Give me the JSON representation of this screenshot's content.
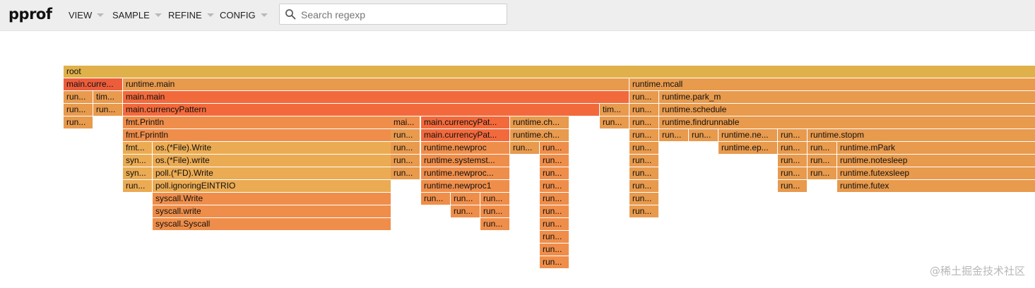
{
  "app": {
    "title": "pprof"
  },
  "menu": [
    {
      "label": "VIEW"
    },
    {
      "label": "SAMPLE"
    },
    {
      "label": "REFINE"
    },
    {
      "label": "CONFIG"
    }
  ],
  "search": {
    "placeholder": "Search regexp",
    "value": ""
  },
  "flamegraph": {
    "colors": {
      "root": "#e0b14b",
      "hot": "#f26a3c",
      "red": "#ec5d3b",
      "warm": "#ef8e4a",
      "mid": "#e89a4d",
      "light": "#ebab53"
    },
    "frames": [
      {
        "label": "root",
        "color": "root"
      },
      {
        "label": "main.curre...",
        "color": "red"
      },
      {
        "label": "runtime.main",
        "color": "mid"
      },
      {
        "label": "runtime.mcall",
        "color": "mid"
      },
      {
        "label": "run...",
        "color": "mid"
      },
      {
        "label": "tim...",
        "color": "mid"
      },
      {
        "label": "main.main",
        "color": "hot"
      },
      {
        "label": "run...",
        "color": "mid"
      },
      {
        "label": "runtime.park_m",
        "color": "mid"
      },
      {
        "label": "run...",
        "color": "mid"
      },
      {
        "label": "run...",
        "color": "mid"
      },
      {
        "label": "main.currencyPattern",
        "color": "hot"
      },
      {
        "label": "tim...",
        "color": "mid"
      },
      {
        "label": "run...",
        "color": "mid"
      },
      {
        "label": "runtime.schedule",
        "color": "mid"
      },
      {
        "label": "run...",
        "color": "mid"
      },
      {
        "label": "fmt.Println",
        "color": "warm"
      },
      {
        "label": "mai...",
        "color": "warm"
      },
      {
        "label": "main.currencyPat...",
        "color": "hot"
      },
      {
        "label": "runtime.ch...",
        "color": "mid"
      },
      {
        "label": "run...",
        "color": "mid"
      },
      {
        "label": "run...",
        "color": "mid"
      },
      {
        "label": "runtime.findrunnable",
        "color": "mid"
      },
      {
        "label": "fmt.Fprintln",
        "color": "warm"
      },
      {
        "label": "run...",
        "color": "mid"
      },
      {
        "label": "main.currencyPat...",
        "color": "hot"
      },
      {
        "label": "runtime.ch...",
        "color": "mid"
      },
      {
        "label": "run...",
        "color": "mid"
      },
      {
        "label": "run...",
        "color": "mid"
      },
      {
        "label": "run...",
        "color": "mid"
      },
      {
        "label": "runtime.ne...",
        "color": "mid"
      },
      {
        "label": "run...",
        "color": "mid"
      },
      {
        "label": "runtime.stopm",
        "color": "mid"
      },
      {
        "label": "fmt...",
        "color": "light"
      },
      {
        "label": "os.(*File).Write",
        "color": "light"
      },
      {
        "label": "run...",
        "color": "mid"
      },
      {
        "label": "runtime.newproc",
        "color": "warm"
      },
      {
        "label": "run...",
        "color": "mid"
      },
      {
        "label": "run...",
        "color": "warm"
      },
      {
        "label": "run...",
        "color": "mid"
      },
      {
        "label": "runtime.ep...",
        "color": "mid"
      },
      {
        "label": "run...",
        "color": "mid"
      },
      {
        "label": "run...",
        "color": "mid"
      },
      {
        "label": "runtime.mPark",
        "color": "mid"
      },
      {
        "label": "syn...",
        "color": "light"
      },
      {
        "label": "os.(*File).write",
        "color": "light"
      },
      {
        "label": "run...",
        "color": "mid"
      },
      {
        "label": "runtime.systemst...",
        "color": "warm"
      },
      {
        "label": "run...",
        "color": "warm"
      },
      {
        "label": "run...",
        "color": "mid"
      },
      {
        "label": "run...",
        "color": "mid"
      },
      {
        "label": "run...",
        "color": "mid"
      },
      {
        "label": "runtime.notesleep",
        "color": "mid"
      },
      {
        "label": "syn...",
        "color": "light"
      },
      {
        "label": "poll.(*FD).Write",
        "color": "light"
      },
      {
        "label": "run...",
        "color": "mid"
      },
      {
        "label": "runtime.newproc...",
        "color": "warm"
      },
      {
        "label": "run...",
        "color": "warm"
      },
      {
        "label": "run...",
        "color": "mid"
      },
      {
        "label": "run...",
        "color": "mid"
      },
      {
        "label": "run...",
        "color": "mid"
      },
      {
        "label": "runtime.futexsleep",
        "color": "mid"
      },
      {
        "label": "run...",
        "color": "light"
      },
      {
        "label": "poll.ignoringEINTRIO",
        "color": "light"
      },
      {
        "label": "runtime.newproc1",
        "color": "warm"
      },
      {
        "label": "run...",
        "color": "warm"
      },
      {
        "label": "run...",
        "color": "mid"
      },
      {
        "label": "run...",
        "color": "mid"
      },
      {
        "label": "runtime.futex",
        "color": "mid"
      },
      {
        "label": "syscall.Write",
        "color": "warm"
      },
      {
        "label": "run...",
        "color": "warm"
      },
      {
        "label": "run...",
        "color": "warm"
      },
      {
        "label": "run...",
        "color": "warm"
      },
      {
        "label": "run...",
        "color": "warm"
      },
      {
        "label": "run...",
        "color": "mid"
      },
      {
        "label": "syscall.write",
        "color": "warm"
      },
      {
        "label": "run...",
        "color": "warm"
      },
      {
        "label": "run...",
        "color": "warm"
      },
      {
        "label": "run...",
        "color": "warm"
      },
      {
        "label": "run...",
        "color": "mid"
      },
      {
        "label": "syscall.Syscall",
        "color": "warm"
      },
      {
        "label": "run...",
        "color": "warm"
      },
      {
        "label": "run...",
        "color": "warm"
      },
      {
        "label": "run...",
        "color": "warm"
      },
      {
        "label": "run...",
        "color": "warm"
      },
      {
        "label": "run...",
        "color": "warm"
      }
    ]
  },
  "watermark": {
    "text": "@稀土掘金技术社区"
  }
}
